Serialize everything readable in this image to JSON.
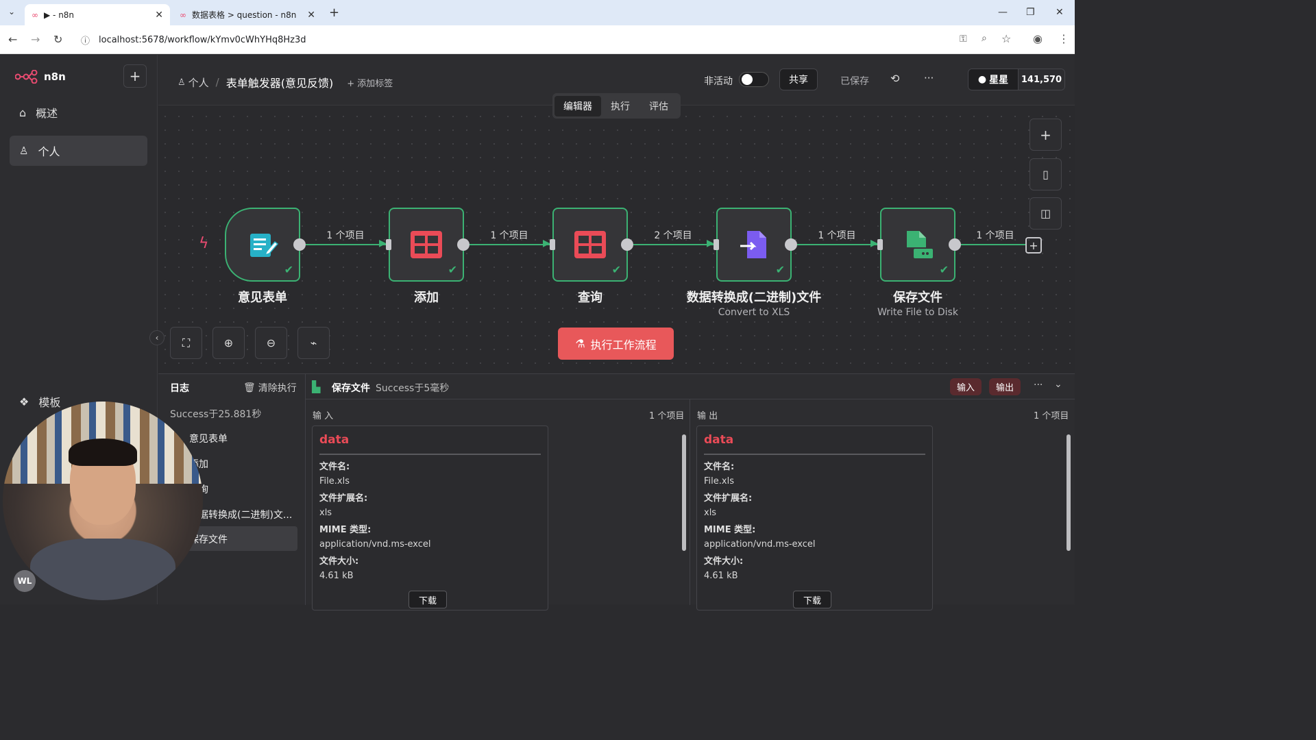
{
  "browser": {
    "tabs": [
      {
        "title": "▶ - n8n"
      },
      {
        "title": "数据表格 > question - n8n"
      }
    ],
    "url": "localhost:5678/workflow/kYmv0cWhYHq8Hz3d"
  },
  "sidebar": {
    "brand": "n8n",
    "items": [
      {
        "label": "概述"
      },
      {
        "label": "个人"
      }
    ],
    "templates_label": "模板",
    "avatar_initials": "WL"
  },
  "header": {
    "breadcrumb_owner": "个人",
    "separator": "/",
    "workflow_name": "表单触发器(意见反馈)",
    "add_tag": "+ 添加标签",
    "inactive_label": "非活动",
    "share_label": "共享",
    "saved_label": "已保存",
    "more_label": "···",
    "github_label": "星星",
    "github_count": "141,570",
    "tabs": [
      {
        "label": "编辑器"
      },
      {
        "label": "执行"
      },
      {
        "label": "评估"
      }
    ]
  },
  "workflow": {
    "nodes": [
      {
        "name": "意见表单",
        "subtitle": ""
      },
      {
        "name": "添加",
        "subtitle": ""
      },
      {
        "name": "查询",
        "subtitle": ""
      },
      {
        "name": "数据转换成(二进制)文件",
        "subtitle": "Convert to XLS"
      },
      {
        "name": "保存文件",
        "subtitle": "Write File to Disk"
      }
    ],
    "connections": [
      "1 个项目",
      "1 个项目",
      "2 个项目",
      "1 个项目",
      "1 个项目"
    ],
    "execute_label": "执行工作流程"
  },
  "logs": {
    "title": "日志",
    "clear_label": "清除执行",
    "summary": "Success于25.881秒",
    "items": [
      "意见表单",
      "添加",
      "查询",
      "数据转换成(二进制)文...",
      "保存文件"
    ],
    "detail_node": "保存文件",
    "detail_status": "Success于5毫秒",
    "input_btn": "输入",
    "output_btn": "输出",
    "input": {
      "label": "输 入",
      "count": "1 个项目"
    },
    "output": {
      "label": "输 出",
      "count": "1 个项目"
    },
    "card": {
      "title": "data",
      "fields": [
        {
          "key": "文件名:",
          "value": "File.xls"
        },
        {
          "key": "文件扩展名:",
          "value": "xls"
        },
        {
          "key": "MIME 类型:",
          "value": "application/vnd.ms-excel"
        },
        {
          "key": "文件大小:",
          "value": "4.61 kB"
        }
      ],
      "download": "下载"
    }
  },
  "colors": {
    "accent": "#ea4b71",
    "success": "#3bb273",
    "execute_button": "#e8585a",
    "bg": "#2b2b2e"
  }
}
